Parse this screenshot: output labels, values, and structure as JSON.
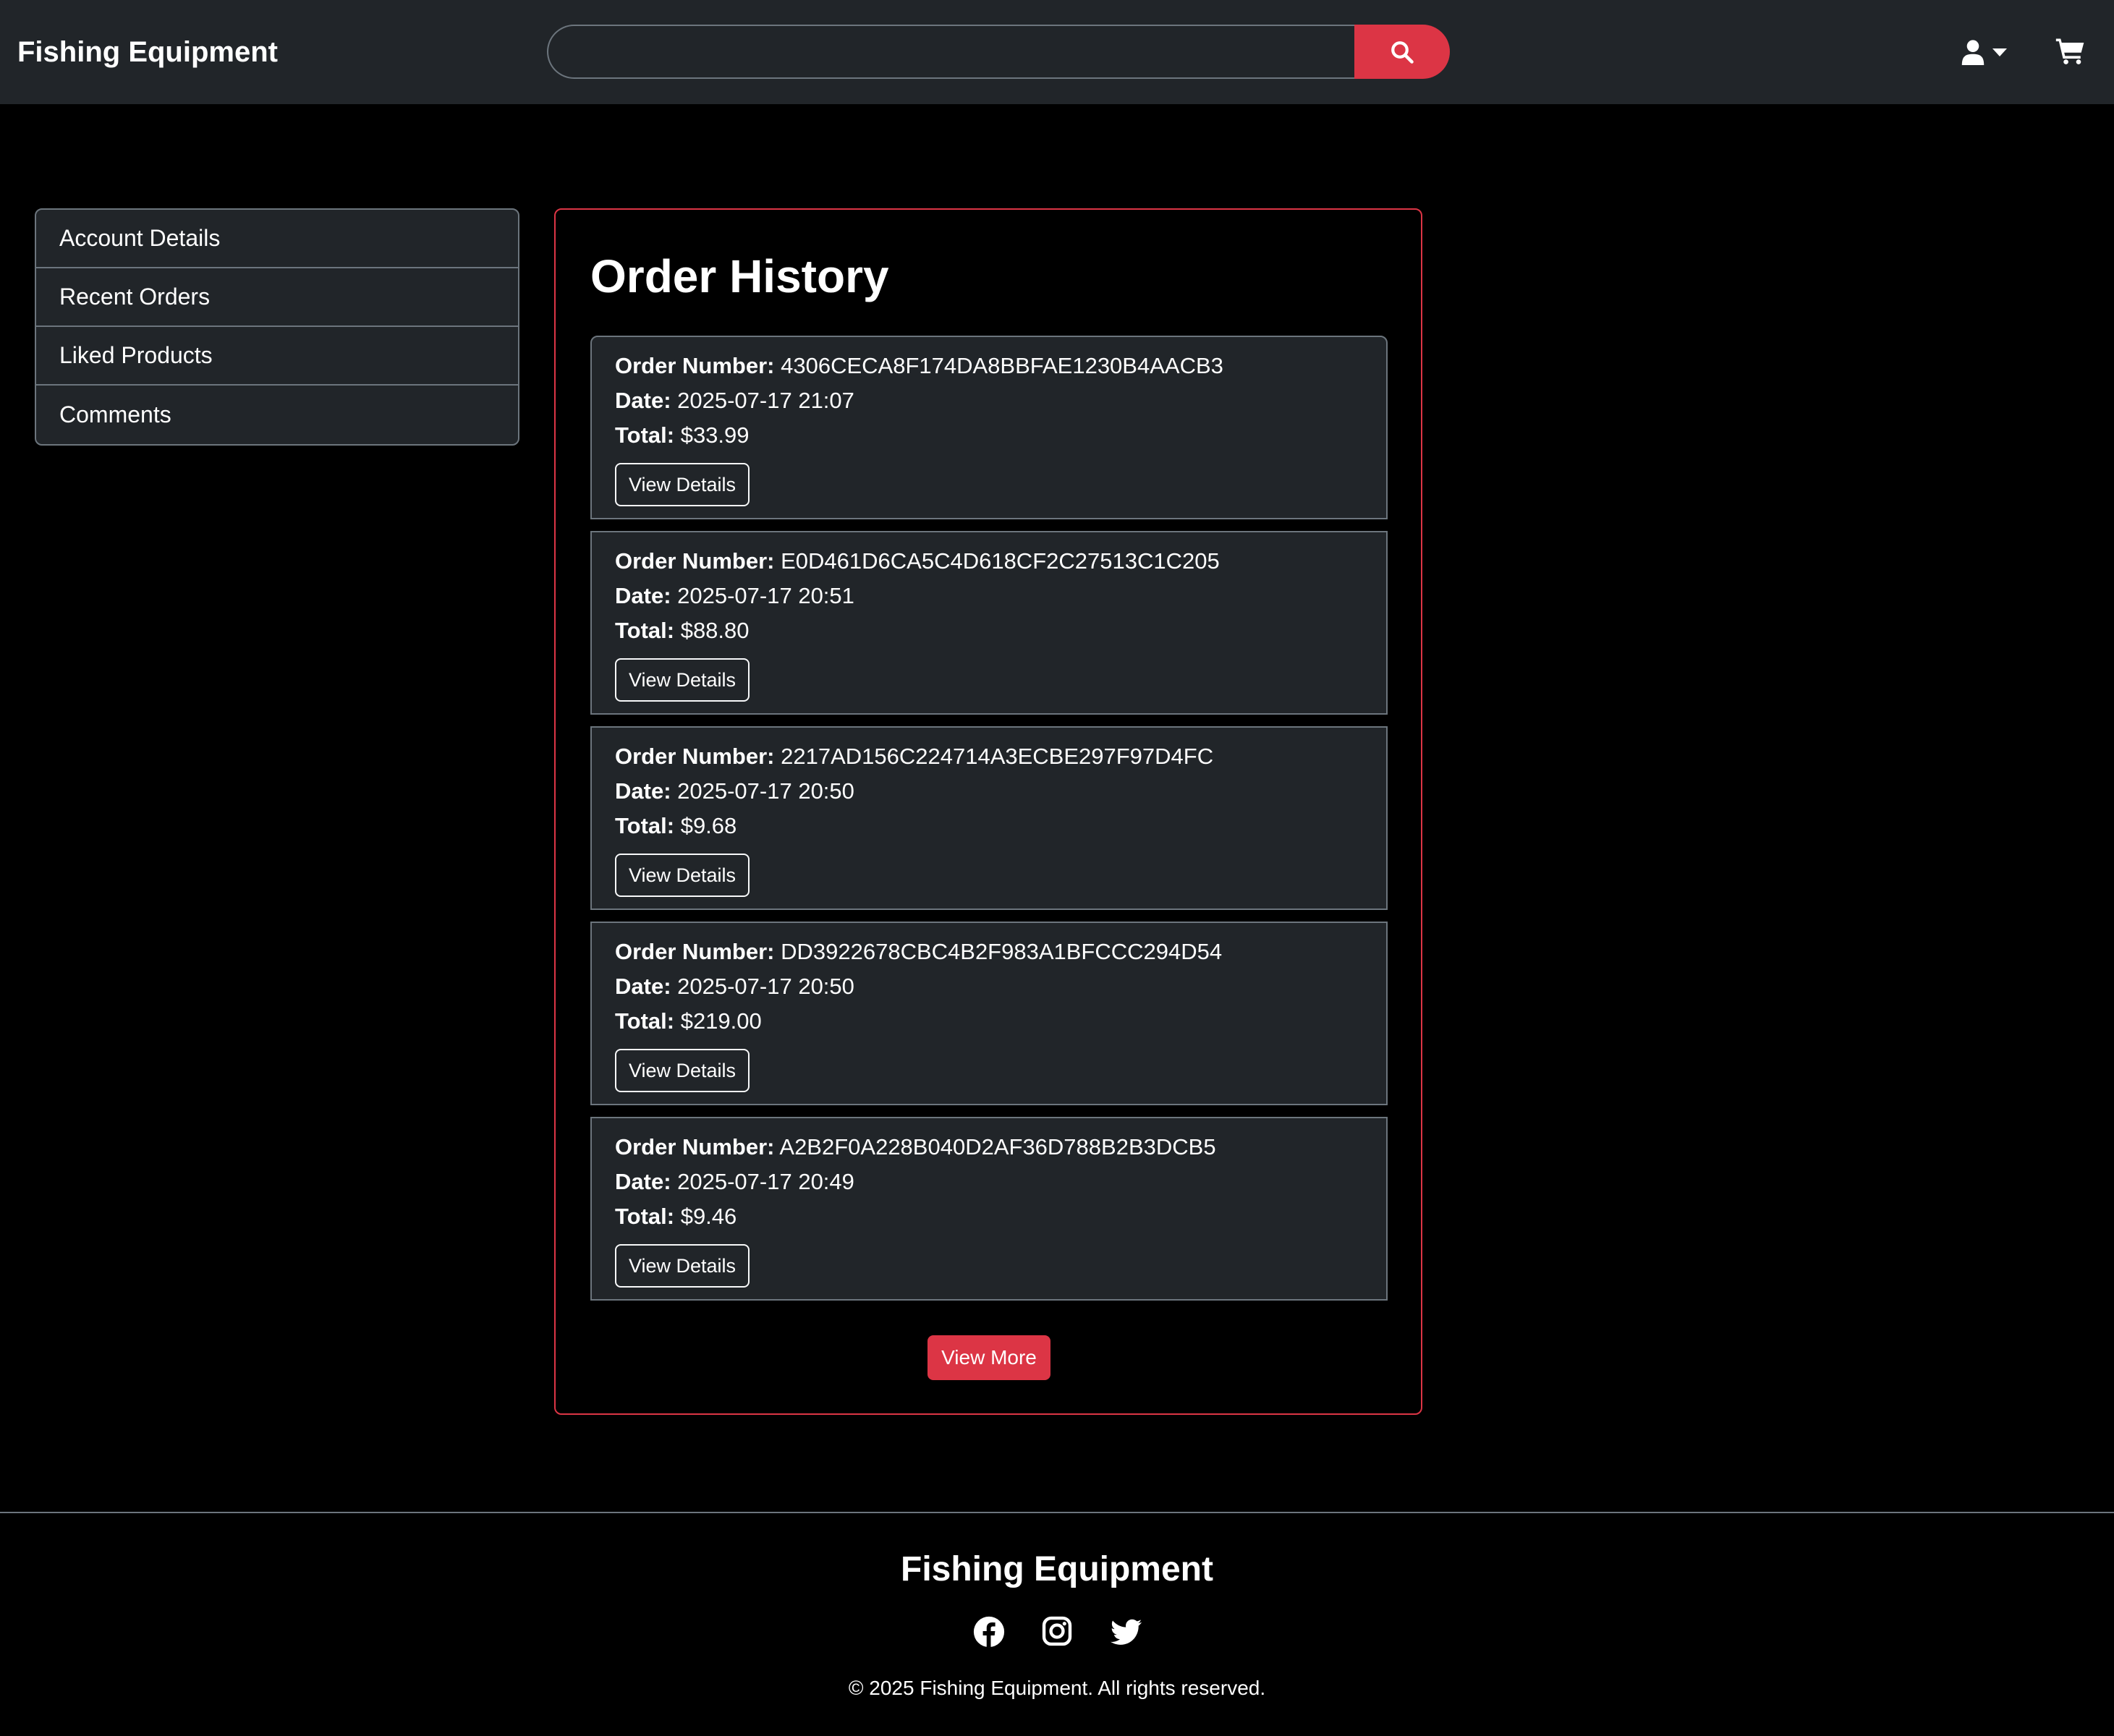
{
  "header": {
    "brand": "Fishing Equipment",
    "search_value": "",
    "search_icon": "search-icon",
    "user_icon": "user-icon",
    "cart_icon": "cart-icon"
  },
  "sidebar": {
    "items": [
      {
        "label": "Account Details"
      },
      {
        "label": "Recent Orders"
      },
      {
        "label": "Liked Products"
      },
      {
        "label": "Comments"
      }
    ]
  },
  "orders": {
    "title": "Order History",
    "labels": {
      "number": "Order Number:",
      "date": "Date:",
      "total": "Total:"
    },
    "view_details_label": "View Details",
    "view_more_label": "View More",
    "items": [
      {
        "number": "4306CECA8F174DA8BBFAE1230B4AACB3",
        "date": "2025-07-17 21:07",
        "total": "$33.99"
      },
      {
        "number": "E0D461D6CA5C4D618CF2C27513C1C205",
        "date": "2025-07-17 20:51",
        "total": "$88.80"
      },
      {
        "number": "2217AD156C224714A3ECBE297F97D4FC",
        "date": "2025-07-17 20:50",
        "total": "$9.68"
      },
      {
        "number": "DD3922678CBC4B2F983A1BFCCC294D54",
        "date": "2025-07-17 20:50",
        "total": "$219.00"
      },
      {
        "number": "A2B2F0A228B040D2AF36D788B2B3DCB5",
        "date": "2025-07-17 20:49",
        "total": "$9.46"
      }
    ]
  },
  "footer": {
    "title": "Fishing Equipment",
    "social_icons": [
      "facebook-icon",
      "instagram-icon",
      "twitter-icon"
    ],
    "copyright": "© 2025 Fishing Equipment. All rights reserved."
  },
  "colors": {
    "navbar_bg": "#212529",
    "page_bg": "#000000",
    "accent": "#dc3545",
    "card_bg": "#212529",
    "border": "#6c757d"
  }
}
